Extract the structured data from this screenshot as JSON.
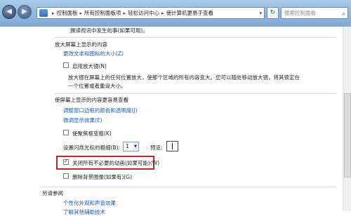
{
  "address_bar": {
    "crumbs": [
      "控制面板",
      "所有控制面板项",
      "轻松访问中心",
      "使计算机更易于查看"
    ]
  },
  "search": {
    "placeholder": "搜索控制面板"
  },
  "content": {
    "top_text": "朗读视讯中发生的事(如果可用)。",
    "magnifier": {
      "heading": "放大屏幕上显示的内容",
      "link": "更改文本和图标的大小(Z)",
      "checkbox_label": "启用放大镜(N)",
      "desc_line1": "放大镜在屏幕上的任何位置放大，使那个区域的所有内容变大。您可以随处移动放大镜，将其锁定在",
      "desc_line2": "一个位置或者重设大小。"
    },
    "easier": {
      "heading": "使屏幕上显示的内容更容易查看",
      "link1": "调整窗口边框的颜色和透明度(J)",
      "link2": "微调显示效果(E)",
      "focus_label": "使聚焦框变粗(K)",
      "cursor_label": "设置闪烁光标的粗细(B):",
      "cursor_value": "1",
      "preview_label": "预览:",
      "animations_label": "关闭所有不必要的动画(如果可能)(W)",
      "animations_checked": true,
      "background_label": "删除背景图像(如果有)(G)"
    },
    "see_also": {
      "heading": "另请参阅",
      "link1": "个性化外观和声音效果",
      "link2": "了解其他辅助技术"
    }
  }
}
